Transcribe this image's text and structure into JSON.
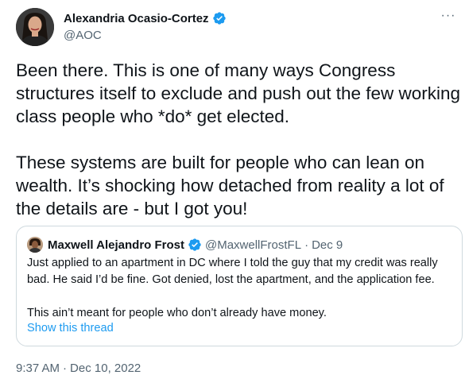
{
  "tweet": {
    "author": {
      "display_name": "Alexandria Ocasio-Cortez",
      "handle": "@AOC",
      "verified": true
    },
    "more_label": "···",
    "text": {
      "paragraph_1": "Been there. This is one of many ways Congress structures itself to exclude and push out the few working class people who *do* get elected.",
      "paragraph_2": "These systems are built for people who can lean on wealth. It’s shocking how detached from reality a lot of the details are - but I got you!"
    },
    "quoted": {
      "display_name": "Maxwell Alejandro Frost",
      "handle": "@MaxwellFrostFL",
      "separator": "·",
      "date": "Dec 9",
      "verified": true,
      "paragraph_1": "Just applied to an apartment in DC where I told the guy that my credit was really bad. He said I’d be fine. Got denied, lost the apartment, and the application fee.",
      "paragraph_2": "This ain’t meant for people who don’t already have money.",
      "thread_link": "Show this thread"
    },
    "timestamp": {
      "time": "9:37 AM",
      "separator": "·",
      "date": "Dec 10, 2022"
    }
  },
  "colors": {
    "text_primary": "#0f1419",
    "text_secondary": "#536471",
    "accent": "#1d9bf0",
    "border": "#cfd9de"
  },
  "icons": {
    "verified": "verified-badge-icon",
    "more": "more-icon"
  }
}
